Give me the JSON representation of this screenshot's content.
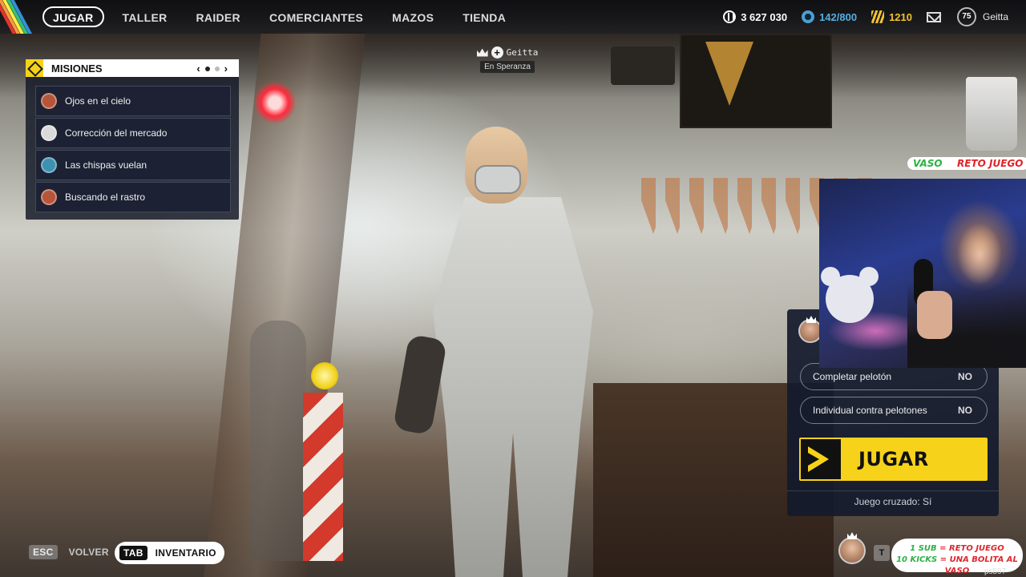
{
  "nav": {
    "tabs": [
      {
        "label": "JUGAR",
        "active": true
      },
      {
        "label": "TALLER",
        "active": false
      },
      {
        "label": "RAIDER",
        "active": false
      },
      {
        "label": "COMERCIANTES",
        "active": false
      },
      {
        "label": "MAZOS",
        "active": false
      },
      {
        "label": "TIENDA",
        "active": false
      }
    ],
    "stripe_colors": [
      "#e3342f",
      "#f6993f",
      "#ffed4a",
      "#38c172",
      "#3490dc"
    ]
  },
  "currencies": {
    "credits": {
      "value": "3 627 030",
      "icon": "coin-icon"
    },
    "tokens": {
      "value": "142/800",
      "icon": "token-icon",
      "color": "#56aee0"
    },
    "gold": {
      "value": "1210",
      "icon": "gold-bars-icon",
      "color": "#f0c22e"
    }
  },
  "profile": {
    "level": "75",
    "name": "Geitta"
  },
  "missions": {
    "title": "MISIONES",
    "pager": {
      "prev": "‹",
      "next": "›",
      "pages": 2,
      "current": 1
    },
    "items": [
      {
        "label": "Ojos en el cielo",
        "avatar_color": "#b5553a"
      },
      {
        "label": "Corrección del mercado",
        "avatar_color": "#d9d9d9"
      },
      {
        "label": "Las chispas vuelan",
        "avatar_color": "#3f8fb0"
      },
      {
        "label": "Buscando el rastro",
        "avatar_color": "#b5553a"
      }
    ]
  },
  "player_tag": {
    "name": "Geitta",
    "location": "En Speranza"
  },
  "play_panel": {
    "options": [
      {
        "label": "Completar pelotón",
        "value": "NO"
      },
      {
        "label": "Individual contra pelotones",
        "value": "NO"
      }
    ],
    "play_label": "JUGAR",
    "crossplay": "Juego cruzado: Sí",
    "accent": "#f7d21a"
  },
  "overlay": {
    "vaso_word": "VASO",
    "vaso_eq": " = ",
    "vaso_result": "RETO JUEGO",
    "sub_line1_a": "1 SUB",
    "sub_line1_b": " = RETO JUEGO",
    "sub_line2_a": "10 KICKS",
    "sub_line2_b": " = UNA BOLITA AL VASO",
    "handle": "ps597"
  },
  "hints": {
    "back_key": "ESC",
    "back_label": "VOLVER",
    "inv_key": "TAB",
    "inv_label": "INVENTARIO",
    "friend_key": "T"
  }
}
